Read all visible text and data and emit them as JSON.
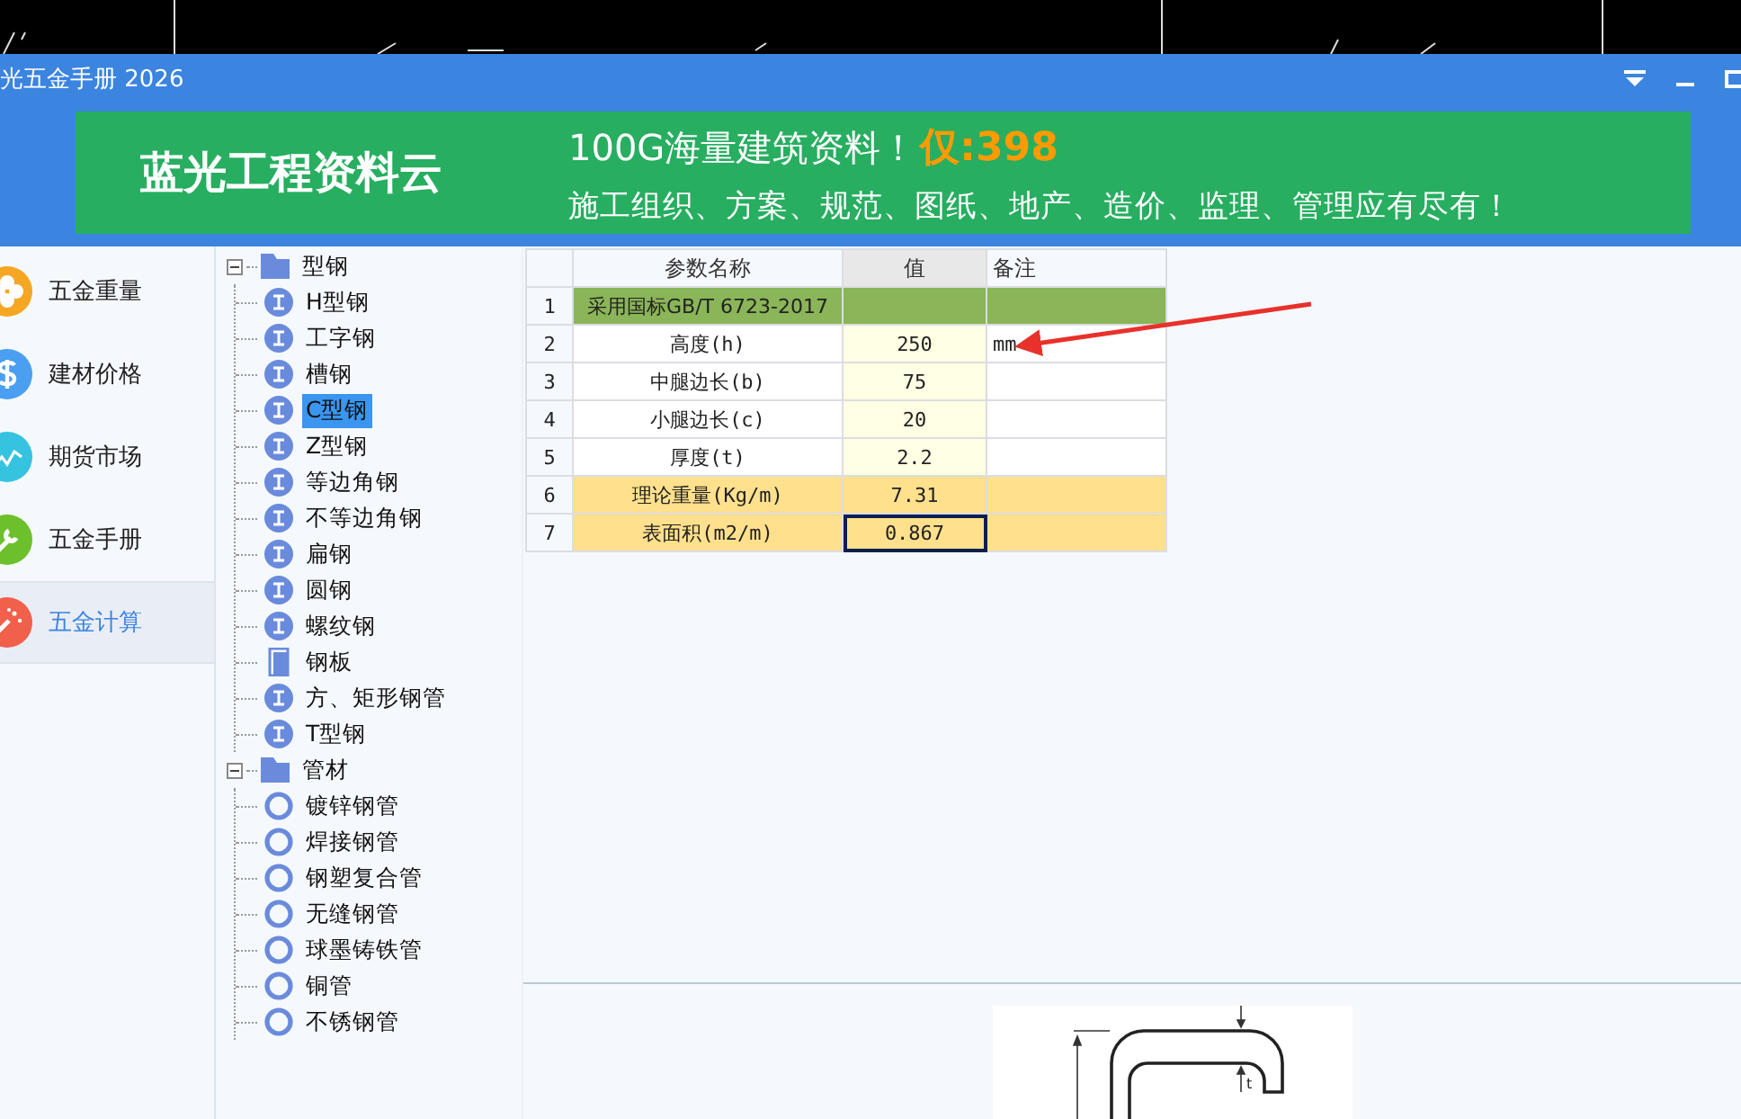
{
  "window": {
    "title": "光五金手册 2026"
  },
  "banner": {
    "brand": "蓝光工程资料云",
    "headline": "100G海量建筑资料！",
    "price": "仅:398",
    "tagline": "施工组织、方案、规范、图纸、地产、造价、监理、管理应有尽有！"
  },
  "nav": [
    {
      "label": "五金重量",
      "kind": "flower",
      "color": "#f5a623",
      "selected": false
    },
    {
      "label": "建材价格",
      "kind": "dollar",
      "color": "#4a9ff0",
      "selected": false
    },
    {
      "label": "期货市场",
      "kind": "chart",
      "color": "#35c3e0",
      "selected": false
    },
    {
      "label": "五金手册",
      "kind": "wrench",
      "color": "#6cc02c",
      "selected": false
    },
    {
      "label": "五金计算",
      "kind": "wand",
      "color": "#f0604a",
      "selected": true
    }
  ],
  "tree": [
    {
      "label": "型钢",
      "expanded": true,
      "children": [
        {
          "label": "H型钢",
          "kind": "section",
          "selected": false
        },
        {
          "label": "工字钢",
          "kind": "section",
          "selected": false
        },
        {
          "label": "槽钢",
          "kind": "section",
          "selected": false
        },
        {
          "label": "C型钢",
          "kind": "section",
          "selected": true
        },
        {
          "label": "Z型钢",
          "kind": "section",
          "selected": false
        },
        {
          "label": "等边角钢",
          "kind": "section",
          "selected": false
        },
        {
          "label": "不等边角钢",
          "kind": "section",
          "selected": false
        },
        {
          "label": "扁钢",
          "kind": "section",
          "selected": false
        },
        {
          "label": "圆钢",
          "kind": "section",
          "selected": false
        },
        {
          "label": "螺纹钢",
          "kind": "section",
          "selected": false
        },
        {
          "label": "钢板",
          "kind": "plate",
          "selected": false
        },
        {
          "label": "方、矩形钢管",
          "kind": "section",
          "selected": false
        },
        {
          "label": "T型钢",
          "kind": "section",
          "selected": false
        }
      ]
    },
    {
      "label": "管材",
      "expanded": true,
      "children": [
        {
          "label": "镀锌钢管",
          "kind": "pipe",
          "selected": false
        },
        {
          "label": "焊接钢管",
          "kind": "pipe",
          "selected": false
        },
        {
          "label": "钢塑复合管",
          "kind": "pipe",
          "selected": false
        },
        {
          "label": "无缝钢管",
          "kind": "pipe",
          "selected": false
        },
        {
          "label": "球墨铸铁管",
          "kind": "pipe",
          "selected": false
        },
        {
          "label": "铜管",
          "kind": "pipe",
          "selected": false
        },
        {
          "label": "不锈钢管",
          "kind": "pipe",
          "selected": false
        }
      ]
    }
  ],
  "table": {
    "columns": [
      {
        "label": "参数名称",
        "selected": false
      },
      {
        "label": "值",
        "selected": true
      },
      {
        "label": "备注",
        "selected": false
      }
    ],
    "rows": [
      {
        "index": "1",
        "name": "采用国标GB/T 6723-2017",
        "value": "",
        "note": "",
        "kind": "standard",
        "selected": false
      },
      {
        "index": "2",
        "name": "高度(h)",
        "value": "250",
        "note": "mm",
        "kind": "input",
        "selected": false
      },
      {
        "index": "3",
        "name": "中腿边长(b)",
        "value": "75",
        "note": "",
        "kind": "input",
        "selected": false
      },
      {
        "index": "4",
        "name": "小腿边长(c)",
        "value": "20",
        "note": "",
        "kind": "input",
        "selected": false
      },
      {
        "index": "5",
        "name": "厚度(t)",
        "value": "2.2",
        "note": "",
        "kind": "input",
        "selected": false
      },
      {
        "index": "6",
        "name": "理论重量(Kg/m)",
        "value": "7.31",
        "note": "",
        "kind": "result",
        "selected": false
      },
      {
        "index": "7",
        "name": "表面积(m2/m)",
        "value": "0.867",
        "note": "",
        "kind": "result",
        "selected": true
      }
    ]
  },
  "diagram": {
    "label": "t"
  }
}
